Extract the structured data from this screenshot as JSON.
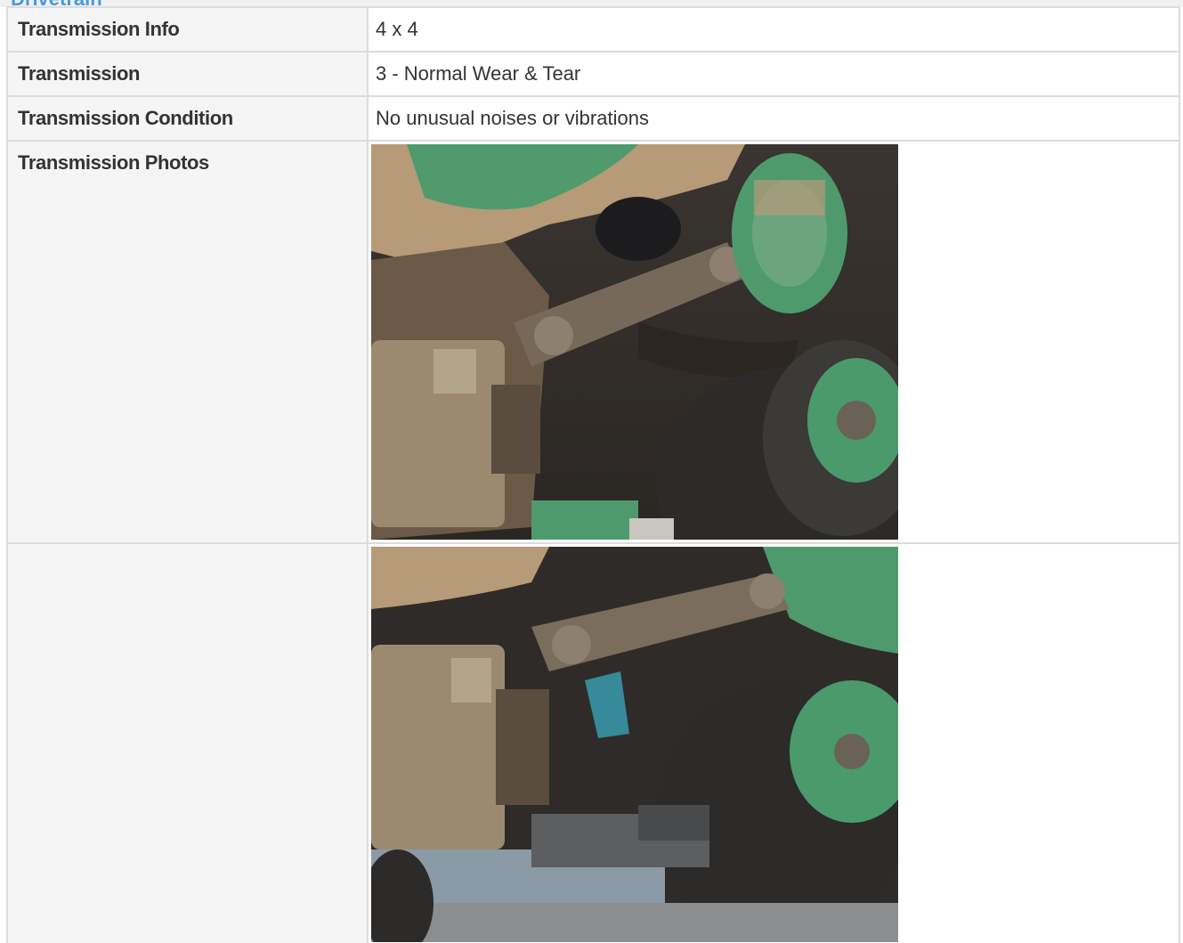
{
  "section": {
    "title": "Drivetrain"
  },
  "rows": [
    {
      "label": "Transmission Info",
      "value": "4 x 4"
    },
    {
      "label": "Transmission",
      "value": "3 - Normal Wear & Tear"
    },
    {
      "label": "Transmission Condition",
      "value": "No unusual noises or vibrations"
    }
  ],
  "photos": {
    "label": "Transmission Photos",
    "items": [
      {
        "alt": "Underside of green tractor showing driveshaft, leaf springs and green wheel"
      },
      {
        "alt": "Underside of green tractor showing driveshaft and tire with parked vehicles in background"
      }
    ]
  },
  "colors": {
    "label_bg": "#f5f5f5",
    "border": "#dcdcdc",
    "accent": "#4a9bd9",
    "tractor_green": "#3f9a68"
  }
}
